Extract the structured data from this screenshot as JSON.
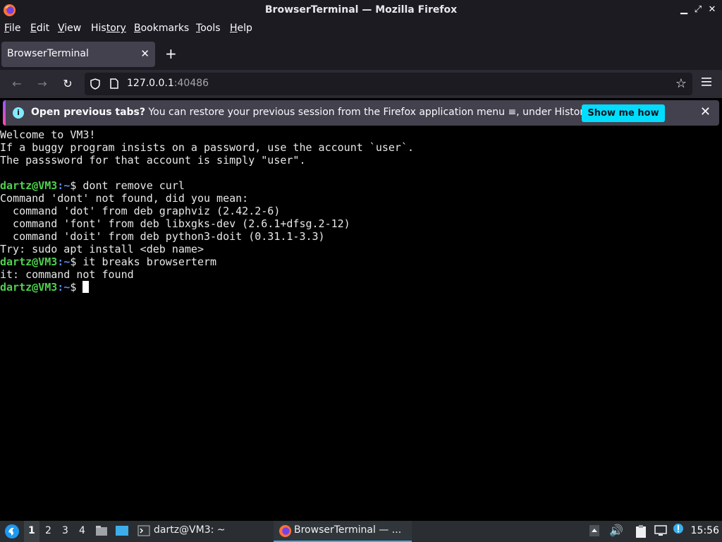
{
  "window": {
    "title": "BrowserTerminal — Mozilla Firefox"
  },
  "menu": {
    "items": [
      {
        "accel": "F",
        "rest": "ile"
      },
      {
        "accel": "E",
        "rest": "dit"
      },
      {
        "accel": "V",
        "rest": "iew"
      },
      {
        "accel": "His",
        "rest": "tory",
        "underline_index": 3
      },
      {
        "accel": "B",
        "rest": "ookmarks"
      },
      {
        "accel": "T",
        "rest": "ools"
      },
      {
        "accel": "H",
        "rest": "elp"
      }
    ]
  },
  "tab": {
    "label": "BrowserTerminal",
    "close": "✕",
    "new": "+"
  },
  "urlbar": {
    "host": "127.0.0.1",
    "port": ":40486"
  },
  "notification": {
    "bold": "Open previous tabs?",
    "text": " You can restore your previous session from the Firefox application menu ≡, under History.",
    "button": "Show me how",
    "close": "✕"
  },
  "terminal": {
    "lines": [
      {
        "text": "Welcome to VM3!"
      },
      {
        "text": "If a buggy program insists on a password, use the account `user`."
      },
      {
        "text": "The passsword for that account is simply \"user\"."
      },
      {
        "text": ""
      },
      {
        "user": "dartz@VM3",
        "path": ":~",
        "cmd": "$ dont remove curl"
      },
      {
        "text": "Command 'dont' not found, did you mean:"
      },
      {
        "text": "  command 'dot' from deb graphviz (2.42.2-6)"
      },
      {
        "text": "  command 'font' from deb libxgks-dev (2.6.1+dfsg.2-12)"
      },
      {
        "text": "  command 'doit' from deb python3-doit (0.31.1-3.3)"
      },
      {
        "text": "Try: sudo apt install <deb name>"
      },
      {
        "user": "dartz@VM3",
        "path": ":~",
        "cmd": "$ it breaks browserterm"
      },
      {
        "text": "it: command not found"
      },
      {
        "user": "dartz@VM3",
        "path": ":~",
        "cmd": "$ ",
        "cursor": true
      }
    ]
  },
  "taskbar": {
    "workspaces": [
      "1",
      "2",
      "3",
      "4"
    ],
    "active_workspace": "1",
    "tasks": [
      {
        "label": "dartz@VM3: ~",
        "icon": "terminal-icon"
      },
      {
        "label": "BrowserTerminal — ...",
        "icon": "firefox-icon"
      }
    ],
    "clock": "15:56"
  },
  "colors": {
    "accent": "#00ddff",
    "prompt_user": "#50d050",
    "prompt_path": "#5b8af0",
    "chrome_dark": "#1c1b22"
  }
}
